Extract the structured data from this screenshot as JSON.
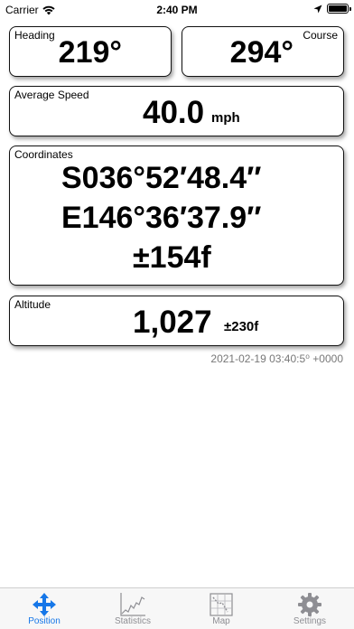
{
  "status_bar": {
    "carrier": "Carrier",
    "time": "2:40 PM"
  },
  "heading": {
    "label": "Heading",
    "value": "219°"
  },
  "course": {
    "label": "Course",
    "value": "294°"
  },
  "speed": {
    "label": "Average Speed",
    "value": "40.0",
    "unit": "mph"
  },
  "coordinates": {
    "label": "Coordinates",
    "latitude": "S036°52′48.4″",
    "longitude": "E146°36′37.9″",
    "accuracy": "±154f"
  },
  "altitude": {
    "label": "Altitude",
    "value": "1,027",
    "accuracy": "±230f"
  },
  "timestamp": "2021-02-19 03:40:5⁰ +0000",
  "tabs": [
    {
      "label": "Position",
      "icon": "move-arrows-icon",
      "active": true
    },
    {
      "label": "Statistics",
      "icon": "line-chart-icon",
      "active": false
    },
    {
      "label": "Map",
      "icon": "map-icon",
      "active": false
    },
    {
      "label": "Settings",
      "icon": "gear-icon",
      "active": false
    }
  ],
  "colors": {
    "accent": "#1677e8",
    "inactive": "#8e8e93",
    "timestamp": "#777777"
  }
}
